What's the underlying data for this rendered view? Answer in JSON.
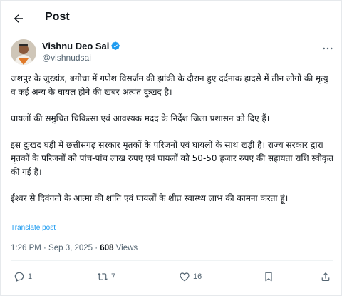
{
  "header": {
    "title": "Post"
  },
  "author": {
    "name": "Vishnu Deo Sai",
    "handle": "@vishnudsai"
  },
  "tweet": {
    "paragraphs": [
      "जशपुर के जुरडांड, बगीचा में गणेश विसर्जन की झांकी के दौरान हुए दर्दनाक हादसे में तीन लोगों की मृत्यु व कई अन्य के घायल होने की खबर अत्यंत दुःखद है।",
      "घायलों की समुचित चिकित्सा एवं आवश्यक मदद के निर्देश जिला प्रशासन को दिए हैं।",
      "इस दुःखद घड़ी में छत्तीसगढ़ सरकार मृतकों के परिजनों एवं घायलों के साथ खड़ी है। राज्य सरकार द्वारा मृतकों के परिजनों को पांच-पांच लाख रुपए एवं घायलों को 50-50 हजार रुपए की सहायता राशि स्वीकृत की गई है।",
      "ईश्वर से दिवंगतों के आत्मा की शांति एवं घायलों के शीघ्र स्वास्थ्य लाभ की कामना करता हूं।"
    ],
    "translate_label": "Translate post",
    "timestamp": "1:26 PM · Sep 3, 2025 · ",
    "views_count": "608",
    "views_label": " Views"
  },
  "actions": {
    "reply_count": "1",
    "repost_count": "7",
    "like_count": "16"
  },
  "icons": {
    "back": "arrow-left-icon",
    "verified": "verified-badge-icon",
    "more": "more-icon",
    "reply": "reply-icon",
    "repost": "repost-icon",
    "like": "heart-icon",
    "bookmark": "bookmark-icon",
    "share": "share-icon"
  },
  "colors": {
    "accent": "#1d9bf0",
    "text": "#0f1419",
    "muted": "#536471"
  }
}
